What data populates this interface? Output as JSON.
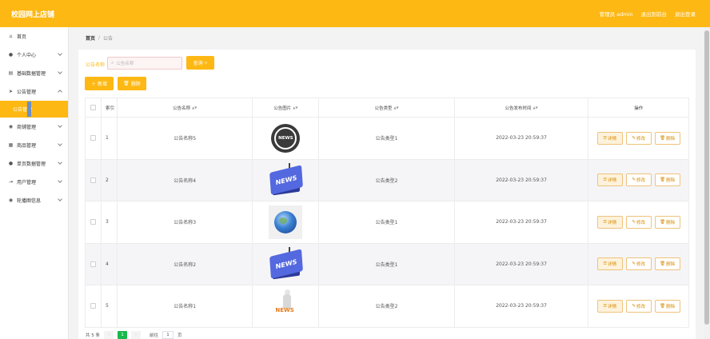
{
  "header": {
    "brand": "校园网上店铺",
    "admin_label": "管理员 admin",
    "home_link": "退出到前台",
    "logout_link": "退出登录"
  },
  "sidebar": {
    "items": [
      {
        "label": "首页",
        "icon": "home-icon"
      },
      {
        "label": "个人中心",
        "icon": "user-icon"
      },
      {
        "label": "基础数据管理",
        "icon": "database-icon"
      },
      {
        "label": "公告管理",
        "icon": "send-icon"
      }
    ],
    "active_sub": "公告管理",
    "items_after": [
      {
        "label": "商铺管理",
        "icon": "location-icon"
      },
      {
        "label": "商品管理",
        "icon": "box-icon"
      },
      {
        "label": "单页数据管理",
        "icon": "user-icon"
      },
      {
        "label": "用户管理",
        "icon": "login-icon"
      },
      {
        "label": "轮播图信息",
        "icon": "location-icon"
      }
    ]
  },
  "breadcrumb": {
    "home": "首页",
    "separator": "/",
    "current": "公告"
  },
  "search": {
    "label": "公告名称",
    "placeholder": "公告名称",
    "button": "查询"
  },
  "actions": {
    "add": "新增",
    "delete": "删除"
  },
  "table": {
    "columns": [
      "索引",
      "公告名称",
      "公告图片",
      "公告类型",
      "公告发布时间",
      "操作"
    ],
    "op_labels": {
      "detail": "详情",
      "edit": "修改",
      "delete": "删除"
    },
    "rows": [
      {
        "index": "1",
        "name": "公告名称5",
        "image": "news-round",
        "type": "公告类型1",
        "time": "2022-03-23 20:59:37"
      },
      {
        "index": "2",
        "name": "公告名称4",
        "image": "news-flag",
        "type": "公告类型2",
        "time": "2022-03-23 20:59:37"
      },
      {
        "index": "3",
        "name": "公告名称3",
        "image": "globe",
        "type": "公告类型1",
        "time": "2022-03-23 20:59:37"
      },
      {
        "index": "4",
        "name": "公告名称2",
        "image": "news-flag",
        "type": "公告类型1",
        "time": "2022-03-23 20:59:37"
      },
      {
        "index": "5",
        "name": "公告名称1",
        "image": "news-figure",
        "type": "公告类型2",
        "time": "2022-03-23 20:59:37"
      }
    ]
  },
  "pagination": {
    "total": "共 5 条",
    "current_page": "1",
    "goto_label": "前往",
    "goto_value": "1",
    "page_suffix": "页"
  },
  "colors": {
    "accent": "#fdb813",
    "pager_active": "#19b84b"
  }
}
